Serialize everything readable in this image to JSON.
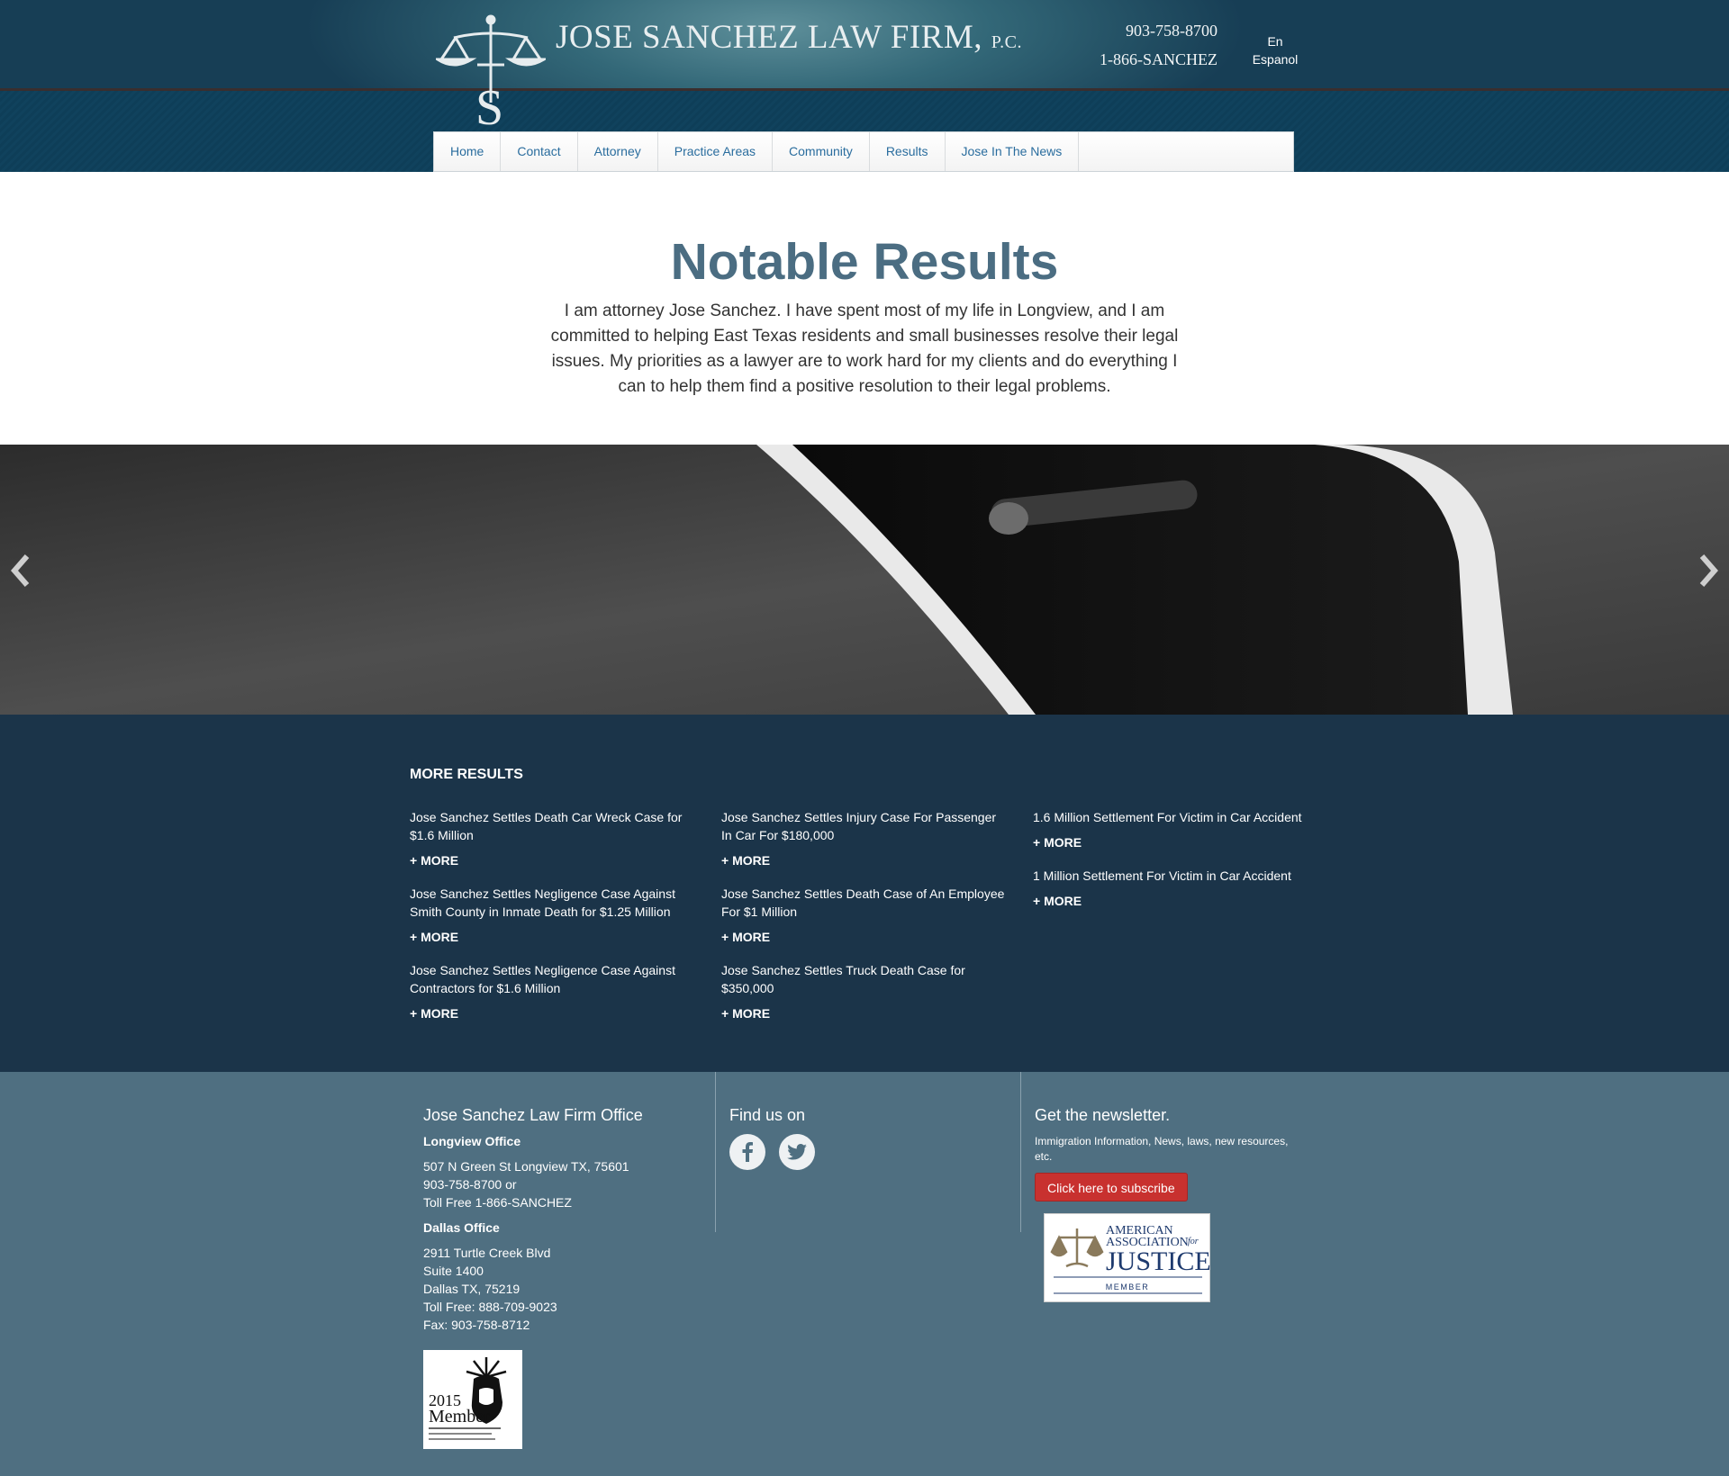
{
  "header": {
    "firm_name": "JOSE SANCHEZ LAW FIRM,",
    "firm_suffix": "P.C.",
    "phone_local": "903-758-8700",
    "phone_toll_free": "1-866-SANCHEZ",
    "lang_en": "En",
    "lang_es": "Espanol"
  },
  "nav": {
    "items": [
      {
        "label": "Home"
      },
      {
        "label": "Contact"
      },
      {
        "label": "Attorney"
      },
      {
        "label": "Practice Areas"
      },
      {
        "label": "Community"
      },
      {
        "label": "Results"
      },
      {
        "label": "Jose In The News"
      }
    ]
  },
  "intro": {
    "title": "Notable Results",
    "text": "I am attorney Jose Sanchez. I have spent most of my life in Longview, and I am committed to helping East Texas residents and small businesses resolve their legal issues. My priorities as a lawyer are to work hard for my clients and do everything I can to help them find a positive resolution to their legal problems."
  },
  "slider": {
    "prev_icon": "chevron-left-icon",
    "next_icon": "chevron-right-icon"
  },
  "results": {
    "heading": "MORE RESULTS",
    "more_label": "+ MORE",
    "columns": [
      [
        {
          "title": "Jose Sanchez Settles Death Car Wreck Case for $1.6 Million"
        },
        {
          "title": "Jose Sanchez Settles Negligence Case Against Smith County in Inmate Death for $1.25 Million"
        },
        {
          "title": "Jose Sanchez Settles Negligence Case Against Contractors for $1.6 Million"
        }
      ],
      [
        {
          "title": "Jose Sanchez Settles Injury Case For Passenger In Car For $180,000"
        },
        {
          "title": "Jose Sanchez Settles Death Case of An Employee For $1 Million"
        },
        {
          "title": "Jose Sanchez Settles Truck Death Case for $350,000"
        }
      ],
      [
        {
          "title": "1.6 Million Settlement For Victim in Car Accident"
        },
        {
          "title": "1 Million Settlement For Victim in Car Accident"
        }
      ]
    ]
  },
  "footer": {
    "office": {
      "title": "Jose Sanchez Law Firm Office",
      "longview_label": "Longview Office",
      "longview_lines": [
        "507 N Green St Longview TX, 75601",
        "903-758-8700 or",
        "Toll Free 1-866-SANCHEZ"
      ],
      "dallas_label": "Dallas Office",
      "dallas_lines": [
        "2911 Turtle Creek Blvd",
        "Suite 1400",
        "Dallas TX, 75219",
        "Toll Free: 888-709-9023",
        "Fax: 903-758-8712"
      ]
    },
    "social": {
      "title": "Find us on",
      "facebook_icon": "facebook-icon",
      "twitter_icon": "twitter-icon"
    },
    "newsletter": {
      "title": "Get the newsletter.",
      "text": "Immigration Information, News, laws, new resources, etc.",
      "button": "Click here to subscribe"
    },
    "aaj_badge": {
      "line1": "AMERICAN",
      "line2": "ASSOCIATION",
      "line2b": "for",
      "line3": "JUSTICE",
      "line4": "MEMBER"
    },
    "member_badge": {
      "year": "2015",
      "word": "Member"
    }
  },
  "colors": {
    "header_dark": "#12374d",
    "nav_link": "#2a6d9e",
    "title_slate": "#4b6d82",
    "results_bg": "#1b3449",
    "footer_bg": "#4f6f81",
    "subscribe_red": "#c8312f"
  }
}
